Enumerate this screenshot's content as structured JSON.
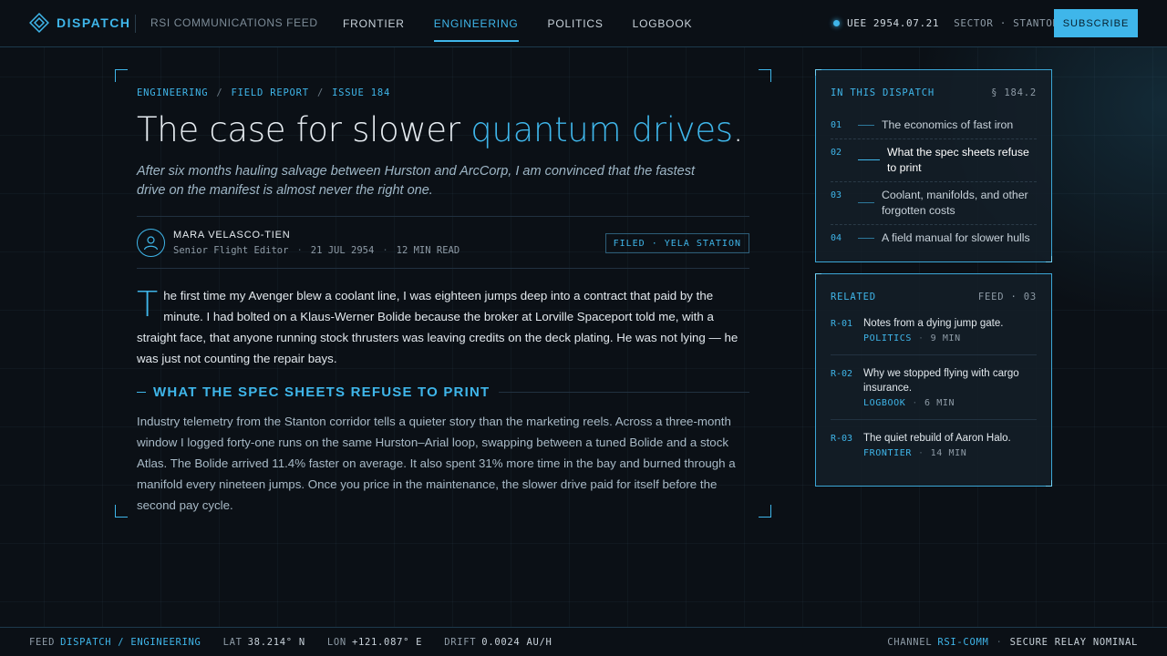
{
  "brand": {
    "name": "DISPATCH",
    "feed": "RSI COMMUNICATIONS FEED"
  },
  "nav": [
    {
      "label": "FRONTIER",
      "active": false
    },
    {
      "label": "ENGINEERING",
      "active": true
    },
    {
      "label": "POLITICS",
      "active": false
    },
    {
      "label": "LOGBOOK",
      "active": false
    }
  ],
  "status": {
    "date": "UEE 2954.07.21",
    "sector_label": "SECTOR",
    "sector": "STANTON"
  },
  "subscribe_label": "SUBSCRIBE",
  "article": {
    "crumbs": [
      "ENGINEERING",
      "FIELD REPORT",
      "ISSUE 184"
    ],
    "title_main": "The case for slower ",
    "title_accent": "quantum drives",
    "title_end": ".",
    "dek": "After six months hauling salvage between Hurston and ArcCorp, I am convinced that the fastest drive on the manifest is almost never the right one.",
    "author": "MARA VELASCO-TIEN",
    "role": "Senior Flight Editor",
    "date": "21 JUL 2954",
    "read": "12 MIN READ",
    "filed": "FILED · YELA STATION",
    "dropcap": "T",
    "lead": "he first time my Avenger blew a coolant line, I was eighteen jumps deep into a contract that paid by the minute. I had bolted on a Klaus-Werner Bolide because the broker at Lorville Spaceport told me, with a straight face, that anyone running stock thrusters was leaving credits on the deck plating. He was not lying — he was just not counting the repair bays.",
    "section_heading": "WHAT THE SPEC SHEETS REFUSE TO PRINT",
    "body": "Industry telemetry from the Stanton corridor tells a quieter story than the marketing reels. Across a three-month window I logged forty-one runs on the same Hurston–Arial loop, swapping between a tuned Bolide and a stock Atlas. The Bolide arrived 11.4% faster on average. It also spent 31% more time in the bay and burned through a manifold every nineteen jumps. Once you price in the maintenance, the slower drive paid for itself before the second pay cycle."
  },
  "toc": {
    "heading": "IN THIS DISPATCH",
    "section": "§ 184.2",
    "items": [
      {
        "num": "01",
        "label": "The economics of fast iron",
        "active": false
      },
      {
        "num": "02",
        "label": "What the spec sheets refuse to print",
        "active": true
      },
      {
        "num": "03",
        "label": "Coolant, manifolds, and other forgotten costs",
        "active": false
      },
      {
        "num": "04",
        "label": "A field manual for slower hulls",
        "active": false
      }
    ]
  },
  "related": {
    "heading": "RELATED",
    "feed": "FEED · 03",
    "items": [
      {
        "id": "R-01",
        "title": "Notes from a dying jump gate.",
        "category": "POLITICS",
        "read": "9 MIN"
      },
      {
        "id": "R-02",
        "title": "Why we stopped flying with cargo insurance.",
        "category": "LOGBOOK",
        "read": "6 MIN"
      },
      {
        "id": "R-03",
        "title": "The quiet rebuild of Aaron Halo.",
        "category": "FRONTIER",
        "read": "14 MIN"
      }
    ]
  },
  "footer": {
    "feed_label": "FEED",
    "feed": "DISPATCH / ENGINEERING",
    "lat_label": "LAT",
    "lat": "38.214° N",
    "lon_label": "LON",
    "lon": "+121.087° E",
    "drift_label": "DRIFT",
    "drift": "0.0024 AU/H",
    "channel_label": "CHANNEL",
    "channel": "RSI-COMM",
    "relay": "SECURE RELAY NOMINAL"
  },
  "colors": {
    "accent": "#3fb6ea",
    "background": "#0b1016"
  }
}
